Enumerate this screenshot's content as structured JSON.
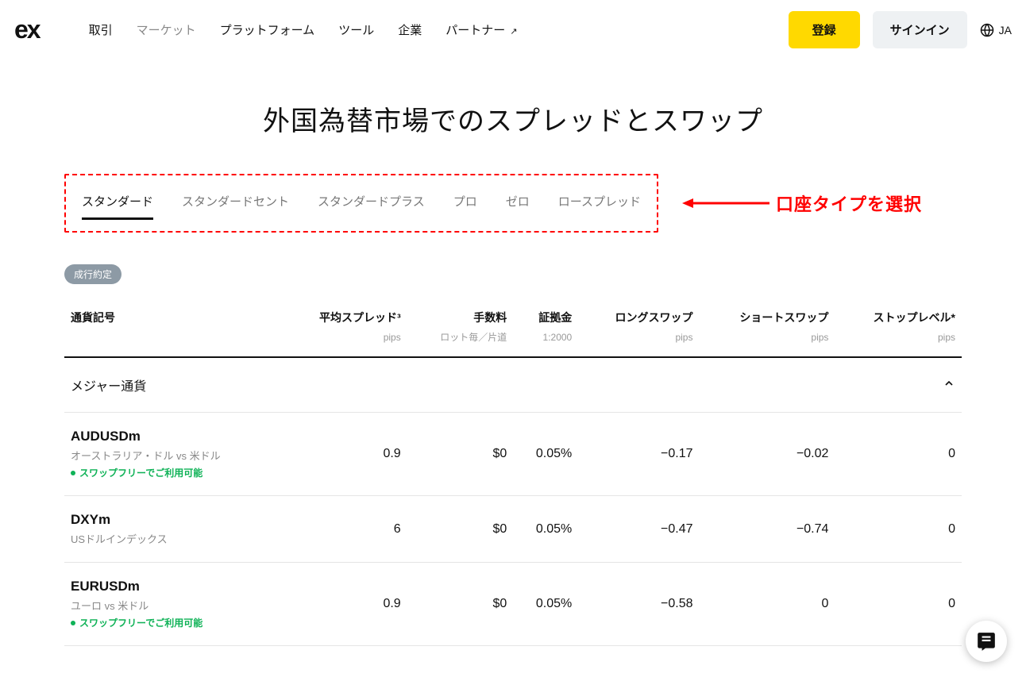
{
  "header": {
    "logo": "ex",
    "nav": [
      "取引",
      "マーケット",
      "プラットフォーム",
      "ツール",
      "企業",
      "パートナー"
    ],
    "nav_active_index": 1,
    "partner_external_glyph": "↗",
    "register": "登録",
    "signin": "サインイン",
    "lang": "JA"
  },
  "page_title": "外国為替市場でのスプレッドとスワップ",
  "tabs": [
    "スタンダード",
    "スタンダードセント",
    "スタンダードプラス",
    "プロ",
    "ゼロ",
    "ロースプレッド"
  ],
  "tab_active_index": 0,
  "annotation": "口座タイプを選択",
  "badge": "成行約定",
  "columns": [
    {
      "label": "通貨記号",
      "sub": ""
    },
    {
      "label": "平均スプレッド³",
      "sub": "pips"
    },
    {
      "label": "手数料",
      "sub": "ロット毎／片道"
    },
    {
      "label": "証拠金",
      "sub": "1:2000"
    },
    {
      "label": "ロングスワップ",
      "sub": "pips"
    },
    {
      "label": "ショートスワップ",
      "sub": "pips"
    },
    {
      "label": "ストップレベル*",
      "sub": "pips"
    }
  ],
  "group_label": "メジャー通貨",
  "rows": [
    {
      "symbol": "AUDUSDm",
      "desc": "オーストラリア・ドル vs 米ドル",
      "swap_free": "スワップフリーでご利用可能",
      "spread": "0.9",
      "fee": "$0",
      "margin": "0.05%",
      "long": "−0.17",
      "short": "−0.02",
      "stop": "0"
    },
    {
      "symbol": "DXYm",
      "desc": "USドルインデックス",
      "swap_free": "",
      "spread": "6",
      "fee": "$0",
      "margin": "0.05%",
      "long": "−0.47",
      "short": "−0.74",
      "stop": "0"
    },
    {
      "symbol": "EURUSDm",
      "desc": "ユーロ vs 米ドル",
      "swap_free": "スワップフリーでご利用可能",
      "spread": "0.9",
      "fee": "$0",
      "margin": "0.05%",
      "long": "−0.58",
      "short": "0",
      "stop": "0"
    }
  ]
}
